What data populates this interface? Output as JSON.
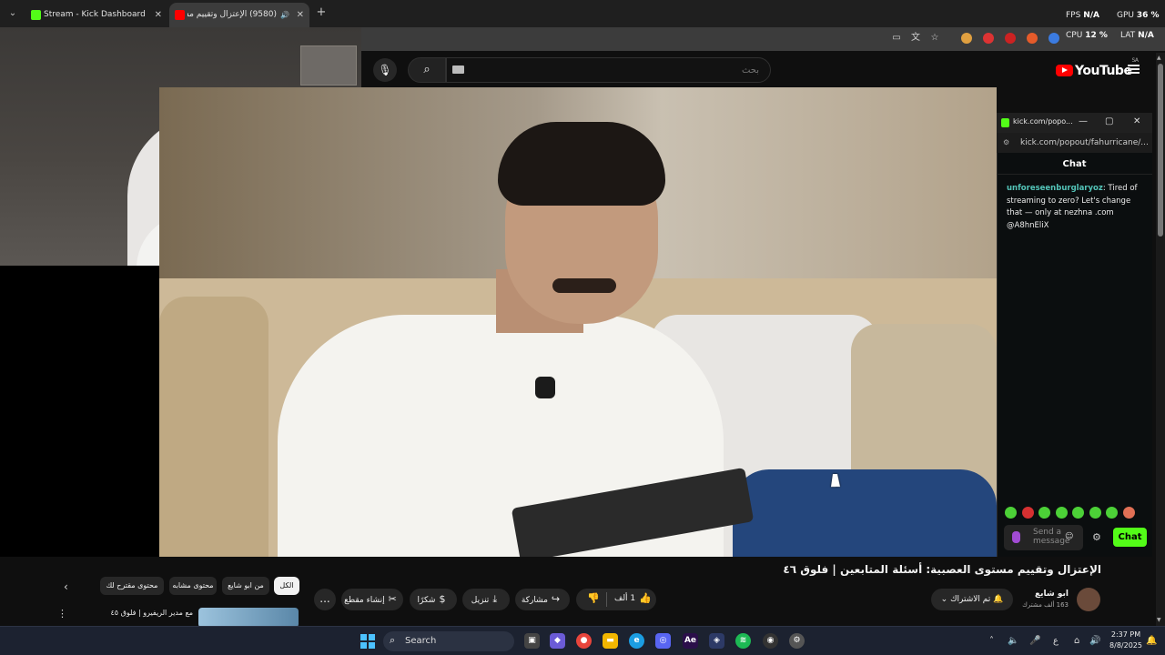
{
  "browser": {
    "tabs": [
      {
        "title": "Stream - Kick Dashboard",
        "favicon_color": "#53fc18"
      },
      {
        "title": "(9580) الإعتزال وتقييم مستو",
        "favicon_color": "#ff0000"
      }
    ],
    "new_tab_label": "+",
    "tab_chevron": "⌄",
    "close_glyph": "✕"
  },
  "perf_overlay": {
    "fps_label": "FPS",
    "fps_value": "N/A",
    "gpu_label": "GPU",
    "gpu_value": "36 %",
    "cpu_label": "CPU",
    "cpu_value": "12 %",
    "lat_label": "LAT",
    "lat_value": "N/A"
  },
  "youtube": {
    "search_placeholder": "بحث",
    "logo_text": "YouTube",
    "logo_region": "SA",
    "video_title": "الإعتزال وتقييم مستوى العصبية: أسئلة المتابعين | فلوق ٤٦",
    "channel_name": "ابو شايع",
    "channel_subs": "163 ألف مشترك",
    "subscribe_label": "تم الاشتراك",
    "like_count": "1 ألف",
    "share_label": "مشاركة",
    "download_label": "تنزيل",
    "thanks_label": "شكرًا",
    "clip_label": "إنشاء مقطع",
    "more_label": "...",
    "chips": [
      "الكل",
      "من ابو شايع",
      "محتوى مشابه",
      "محتوى مقترح لك"
    ],
    "rec_title": "مع مدير الريفيرو | فلوق ٤٥"
  },
  "kick_popout": {
    "window_title": "kick.com/popo...",
    "url": "kick.com/popout/fahurricane/...",
    "header": "Chat",
    "messages": [
      {
        "username": "unforeseenburglaryoz",
        "text": "Tired of streaming to zero? Let's change that — only at nezhna .com @A8hnEliX"
      }
    ],
    "input_placeholder": "Send a message",
    "send_label": "Chat",
    "accent": "#53fc18"
  },
  "taskbar": {
    "search_label": "Search",
    "time": "2:37 PM",
    "date": "8/8/2025",
    "lang": "ع"
  },
  "icons": {
    "search": "⌕",
    "mic": "🎙",
    "thumb_up": "👍",
    "thumb_down": "👎",
    "share": "↪",
    "download": "⤓",
    "scissors": "✂",
    "bell": "🔔",
    "chevron": "⌄",
    "gear": "⚙"
  }
}
